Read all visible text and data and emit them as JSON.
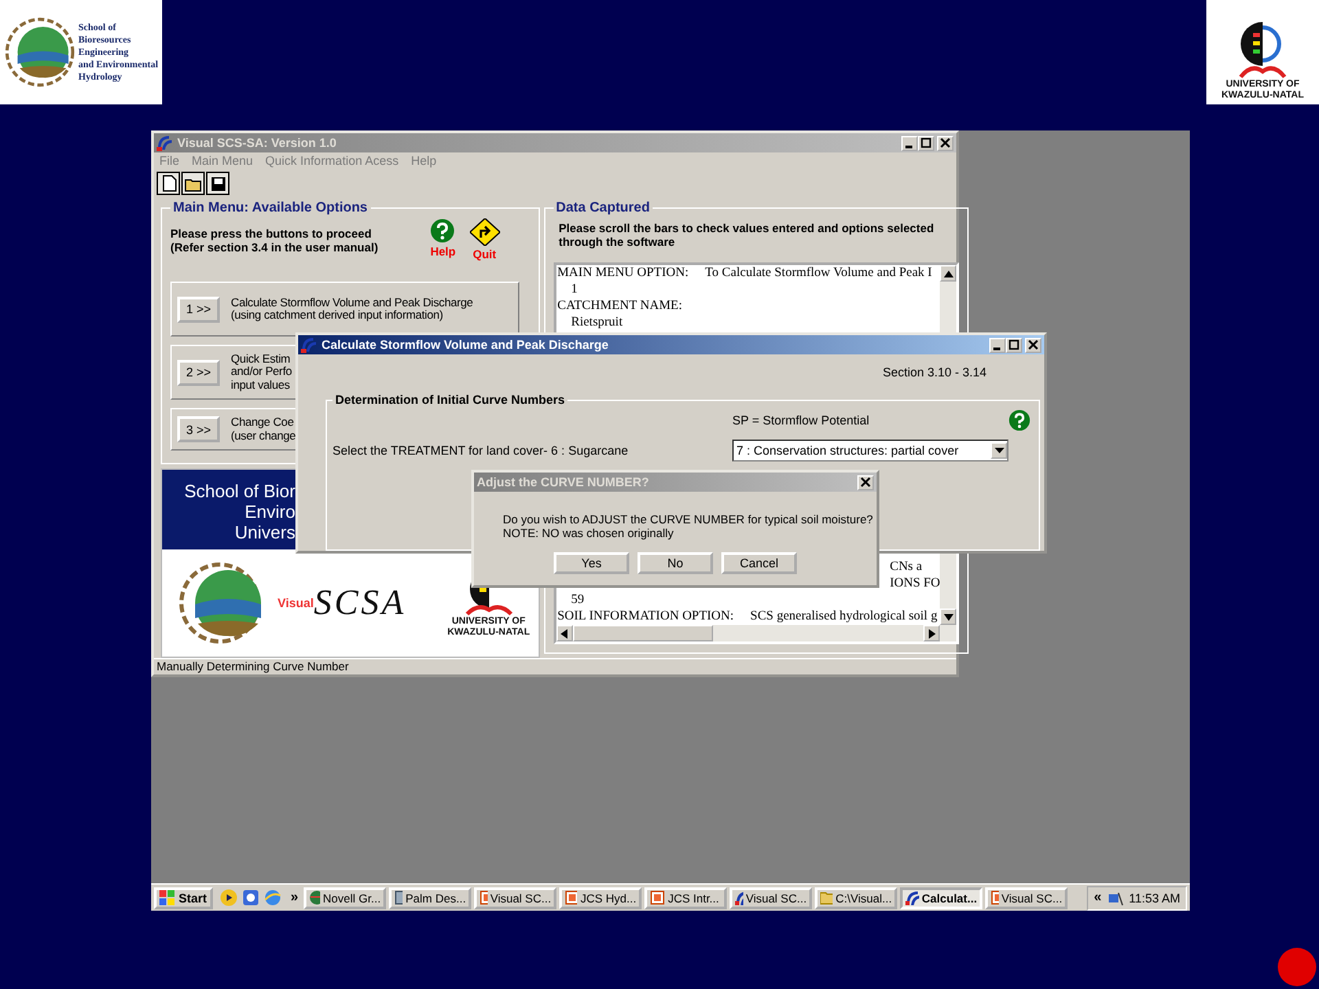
{
  "slide": {
    "left_logo": {
      "lines": [
        "School of",
        "Bioresources",
        "Engineering",
        "and Environmental",
        "Hydrology"
      ]
    },
    "right_logo": {
      "lines": [
        "UNIVERSITY OF",
        "KWAZULU-NATAL"
      ]
    }
  },
  "main_window": {
    "title": "Visual SCS-SA: Version 1.0",
    "active": false,
    "menu": [
      "File",
      "Main Menu",
      "Quick Information Acess",
      "Help"
    ],
    "options_panel": {
      "title": "Main Menu: Available Options",
      "instructions": [
        "Please press the buttons to proceed",
        "(Refer section 3.4 in the user manual)"
      ],
      "help_label": "Help",
      "quit_label": "Quit",
      "options": [
        {
          "button": "1 >>",
          "lines": [
            "Calculate Stormflow Volume and Peak Discharge",
            "(using catchment derived input information)"
          ]
        },
        {
          "button": "2 >>",
          "lines": [
            "Quick Estim",
            "and/or Perfo",
            "input values"
          ]
        },
        {
          "button": "3 >>",
          "lines": [
            "Change Coe",
            "(user change"
          ]
        }
      ]
    },
    "banner": {
      "lines": [
        "School of Bior",
        "Enviro",
        "Univers"
      ],
      "visual_label": "Visual",
      "scsa": "SCSA",
      "university": [
        "UNIVERSITY OF",
        "KWAZULU-NATAL"
      ]
    },
    "data_panel": {
      "title": "Data Captured",
      "instructions": "Please scroll the bars to check values entered and options selected through the software",
      "top_lines": [
        {
          "kind": "field",
          "label": "MAIN MENU OPTION:",
          "value": "To Calculate Stormflow Volume and Peak I"
        },
        {
          "kind": "value",
          "text": "1"
        },
        {
          "kind": "field",
          "label": "CATCHMENT NAME:"
        },
        {
          "kind": "value",
          "text": "Rietspruit"
        }
      ],
      "bottom_lines": [
        {
          "kind": "fragment",
          "text": "CNs a"
        },
        {
          "kind": "fragment",
          "text": "IONS FO"
        },
        {
          "kind": "value",
          "text": "59"
        },
        {
          "kind": "field",
          "label": "SOIL INFORMATION OPTION:",
          "value": "SCS generalised hydrological soil g"
        }
      ]
    },
    "status": "Manually Determining Curve Number"
  },
  "curve_dialog": {
    "title": "Calculate Stormflow Volume and Peak Discharge",
    "active": true,
    "section": "Section 3.10 - 3.14",
    "group_title": "Determination of Initial Curve Numbers",
    "sp_note": "SP = Stormflow Potential",
    "treatment_label": "Select the TREATMENT for land cover- 6 : Sugarcane",
    "treatment_value": "7 : Conservation structures: partial cover"
  },
  "adjust_dialog": {
    "title": "Adjust the CURVE NUMBER?",
    "active": false,
    "message": [
      "Do you wish to ADJUST the CURVE NUMBER for typical soil moisture?",
      "NOTE: NO was chosen originally"
    ],
    "buttons": [
      "Yes",
      "No",
      "Cancel"
    ]
  },
  "taskbar": {
    "start": "Start",
    "more_left": "»",
    "more_right": "«",
    "clock": "11:53 AM",
    "items": [
      {
        "label": "Novell Gr...",
        "selected": false
      },
      {
        "label": "Palm Des...",
        "selected": false
      },
      {
        "label": "Visual SC...",
        "selected": false
      },
      {
        "label": "JCS Hyd...",
        "selected": false
      },
      {
        "label": "JCS Intr...",
        "selected": false
      },
      {
        "label": "Visual SC...",
        "selected": false
      },
      {
        "label": "C:\\Visual...",
        "selected": false
      },
      {
        "label": "Calculat...",
        "selected": true
      },
      {
        "label": "Visual SC...",
        "selected": false
      }
    ]
  }
}
